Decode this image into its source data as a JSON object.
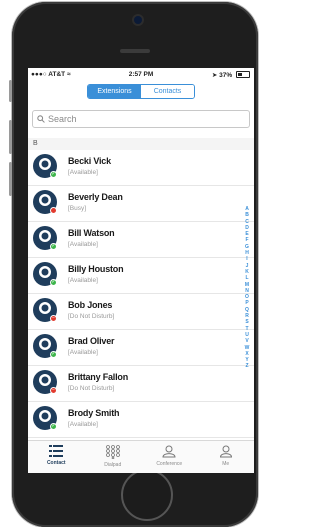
{
  "status_bar": {
    "carrier": "AT&T",
    "time": "2:57 PM",
    "battery": "37%"
  },
  "segmented_control": {
    "tabs": [
      {
        "label": "Extensions",
        "active": true
      },
      {
        "label": "Contacts",
        "active": false
      }
    ]
  },
  "search": {
    "placeholder": "Search"
  },
  "section_header": "B",
  "contacts": [
    {
      "name": "Becki Vick",
      "status": "[Available]",
      "presence": "available"
    },
    {
      "name": "Beverly Dean",
      "status": "[Busy]",
      "presence": "busy"
    },
    {
      "name": "Bill Watson",
      "status": "[Available]",
      "presence": "available"
    },
    {
      "name": "Billy Houston",
      "status": "[Available]",
      "presence": "available"
    },
    {
      "name": "Bob Jones",
      "status": "[Do Not Disturb]",
      "presence": "dnd"
    },
    {
      "name": "Brad Oliver",
      "status": "[Available]",
      "presence": "available"
    },
    {
      "name": "Brittany Fallon",
      "status": "[Do Not Disturb]",
      "presence": "dnd"
    },
    {
      "name": "Brody Smith",
      "status": "[Available]",
      "presence": "available"
    }
  ],
  "alpha_index": [
    "A",
    "B",
    "C",
    "D",
    "E",
    "F",
    "G",
    "H",
    "I",
    "J",
    "K",
    "L",
    "M",
    "N",
    "O",
    "P",
    "Q",
    "R",
    "S",
    "T",
    "U",
    "V",
    "W",
    "X",
    "Y",
    "Z"
  ],
  "tab_bar": {
    "tabs": [
      {
        "label": "Contact",
        "icon": "contacts-list-icon",
        "active": true
      },
      {
        "label": "Dialpad",
        "icon": "dialpad-icon",
        "active": false
      },
      {
        "label": "Conference",
        "icon": "conference-icon",
        "active": false
      },
      {
        "label": "Me",
        "icon": "person-icon",
        "active": false
      }
    ]
  },
  "colors": {
    "accent": "#3a8fd8",
    "available": "#3cb44a",
    "busy": "#e23b2e",
    "dnd": "#e23b2e",
    "avatar": "#1f3d5c"
  }
}
